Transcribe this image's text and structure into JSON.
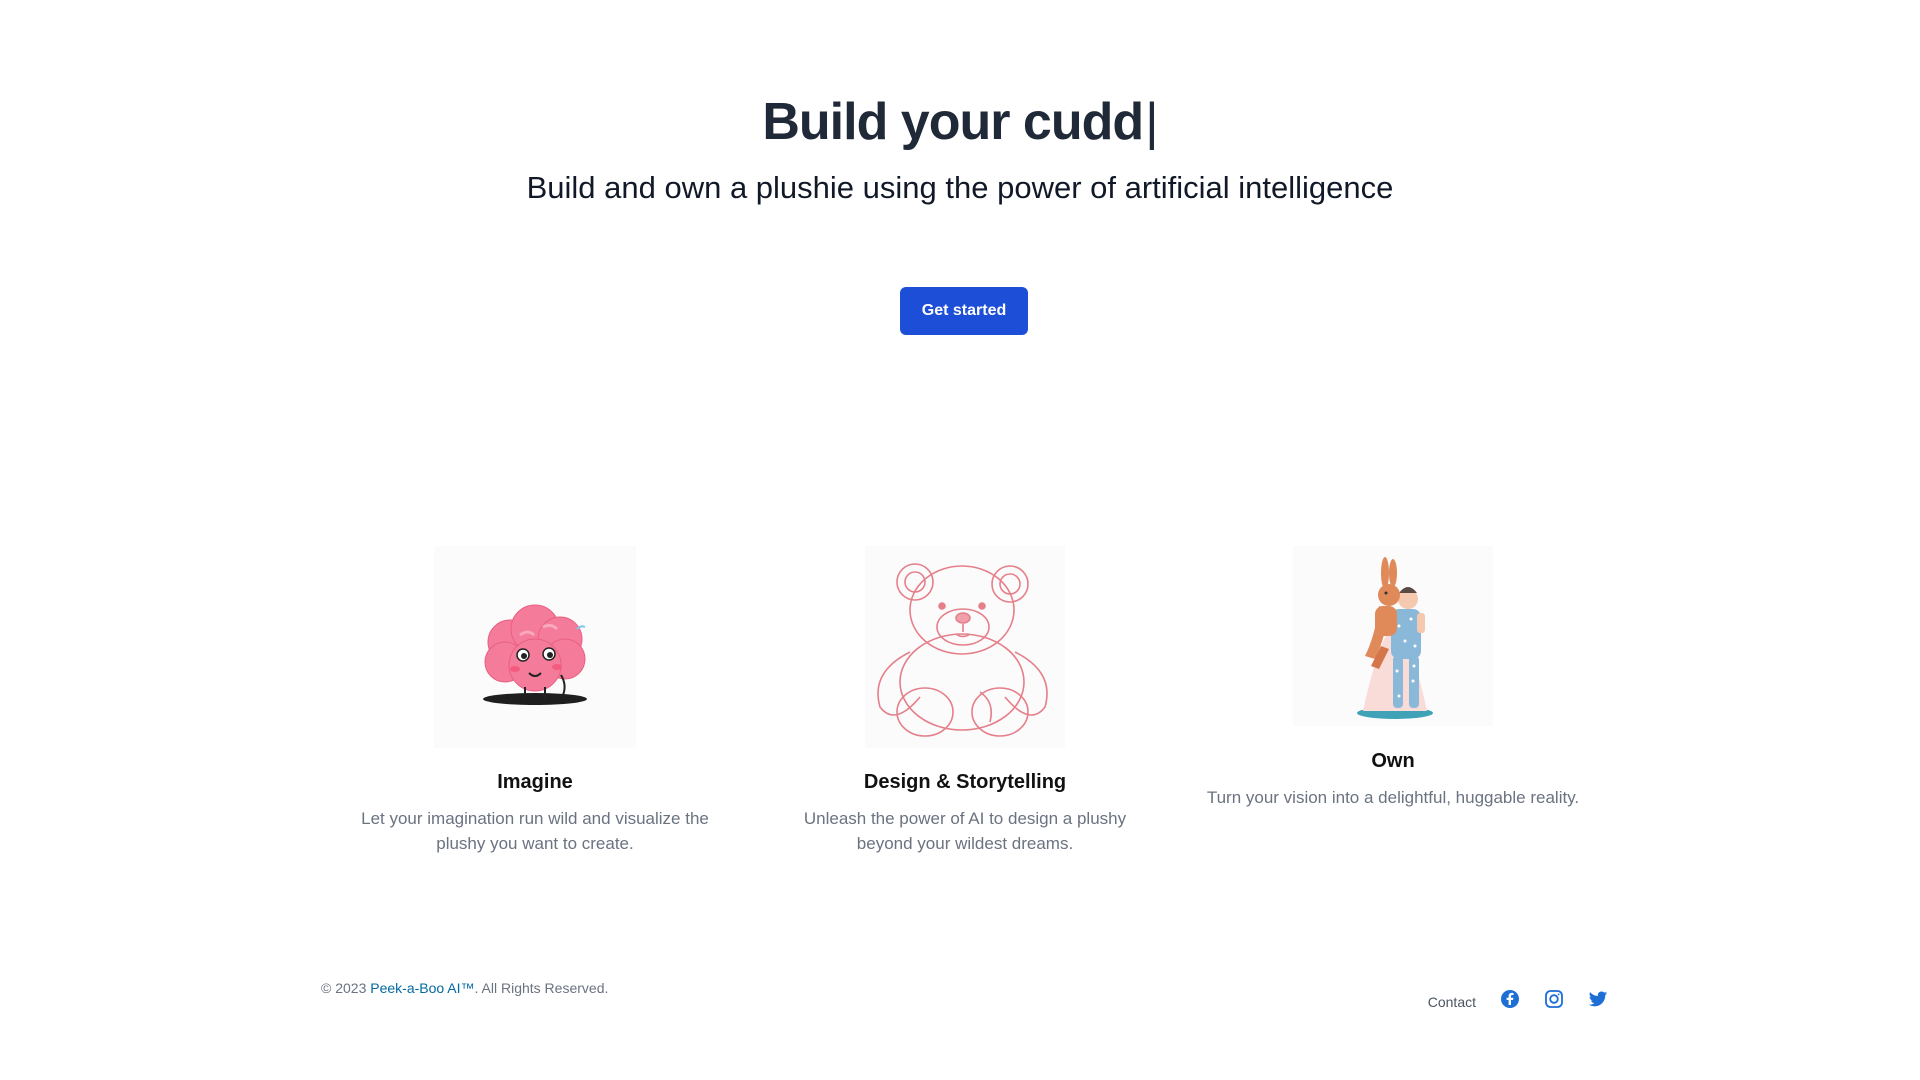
{
  "hero": {
    "title": "Build your cudd",
    "cursor": "|",
    "subtitle": "Build and own a plushie using the power of artificial intelligence",
    "cta_label": "Get started"
  },
  "features": [
    {
      "title": "Imagine",
      "description": "Let your imagination run wild and visualize the plushy you want to create.",
      "image_icon": "pink-brain-character-illustration"
    },
    {
      "title": "Design & Storytelling",
      "description": "Unleash the power of AI to design a plushy beyond your wildest dreams.",
      "image_icon": "teddy-bear-sketch-illustration"
    },
    {
      "title": "Own",
      "description": "Turn your vision into a delightful, huggable reality.",
      "image_icon": "child-hugging-bunny-illustration"
    }
  ],
  "footer": {
    "copyright_prefix": "© 2023 ",
    "brand_name": "Peek-a-Boo AI™",
    "copyright_suffix": ". All Rights Reserved.",
    "contact_label": "Contact",
    "social_icons": [
      "facebook-icon",
      "instagram-icon",
      "twitter-icon"
    ]
  },
  "colors": {
    "primary_button": "#1d4ed8",
    "brand_link": "#0369a1",
    "social_icon": "#1d6fd6",
    "title_text": "#1f2937",
    "muted_text": "#6b7280"
  }
}
